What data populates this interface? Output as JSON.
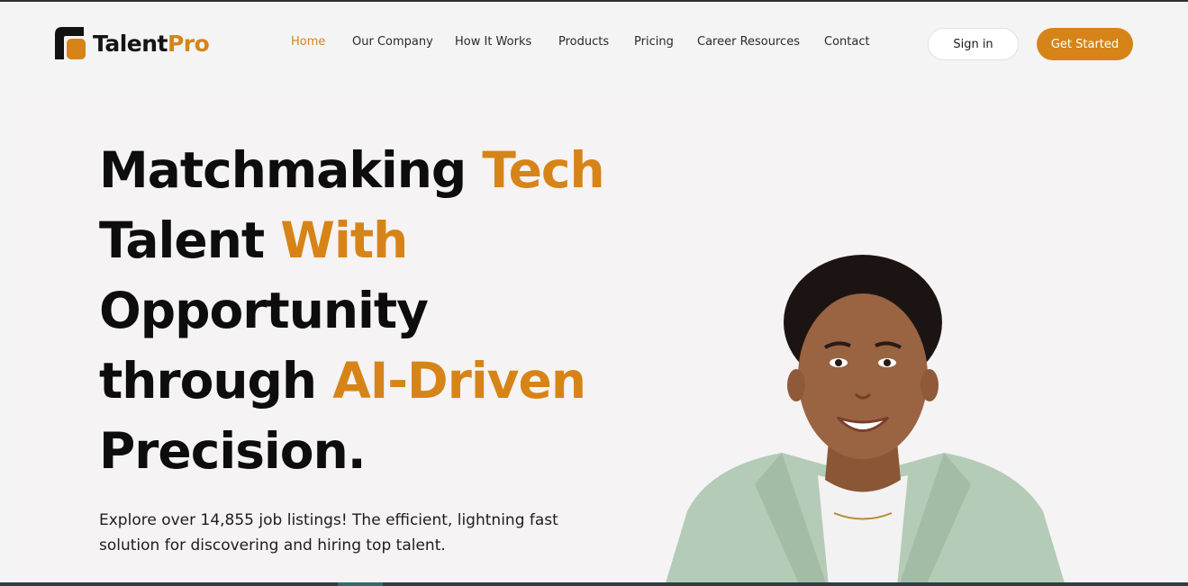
{
  "brand": {
    "name_part1": "Talent",
    "name_part2": "Pro",
    "accent_color": "#d68418"
  },
  "nav": {
    "items": [
      {
        "label": "Home",
        "active": true
      },
      {
        "label": "Our Company",
        "active": false
      },
      {
        "label": "How It Works",
        "active": false
      },
      {
        "label": "Products",
        "active": false
      },
      {
        "label": "Pricing",
        "active": false
      },
      {
        "label": "Career Resources",
        "active": false
      },
      {
        "label": "Contact",
        "active": false
      }
    ]
  },
  "header": {
    "signin_label": "Sign in",
    "get_started_label": "Get Started"
  },
  "hero": {
    "headline": {
      "line1_a": "Matchmaking ",
      "line1_b": "Tech",
      "line2_a": "Talent ",
      "line2_b": "With",
      "line3": "Opportunity",
      "line4_a": "through ",
      "line4_b": "AI-Driven",
      "line5": "Precision."
    },
    "subtext": "Explore over 14,855 job listings! The efficient, lightning fast solution for discovering and hiring top talent.",
    "image_subject": "smiling-woman-portrait"
  }
}
